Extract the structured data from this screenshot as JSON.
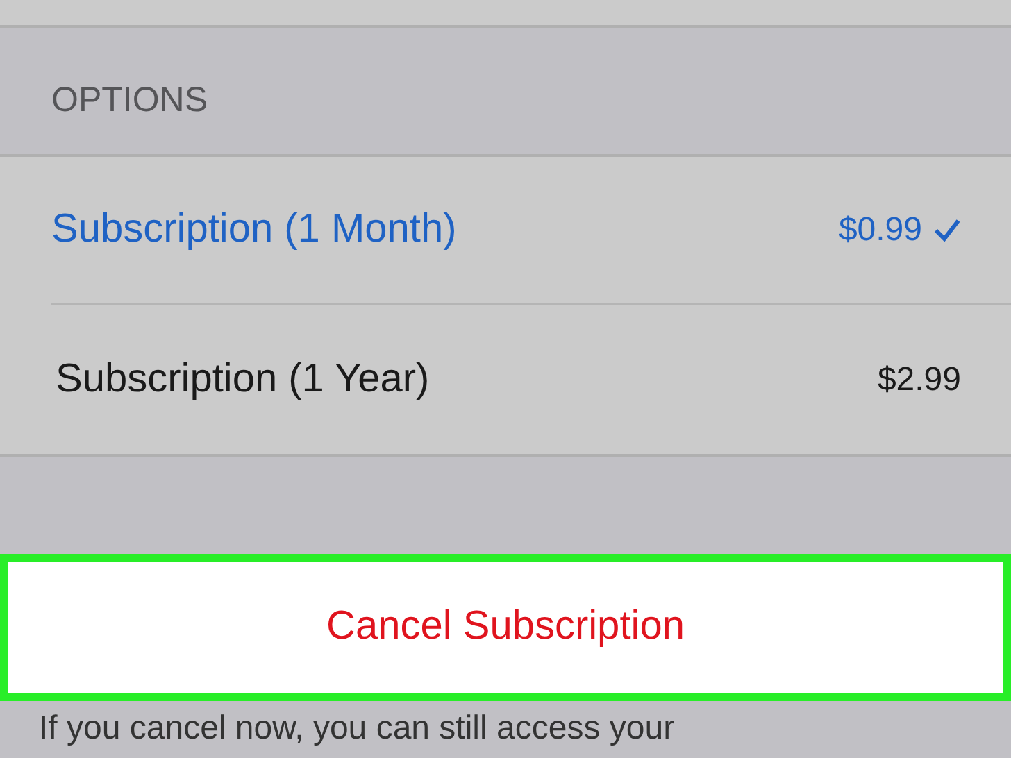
{
  "section": {
    "title": "OPTIONS"
  },
  "options": [
    {
      "label": "Subscription (1 Month)",
      "price": "$0.99",
      "selected": true
    },
    {
      "label": "Subscription (1 Year)",
      "price": "$2.99",
      "selected": false
    }
  ],
  "cancel_button": {
    "label": "Cancel Subscription"
  },
  "footer": {
    "text": "If you cancel now, you can still access your"
  }
}
